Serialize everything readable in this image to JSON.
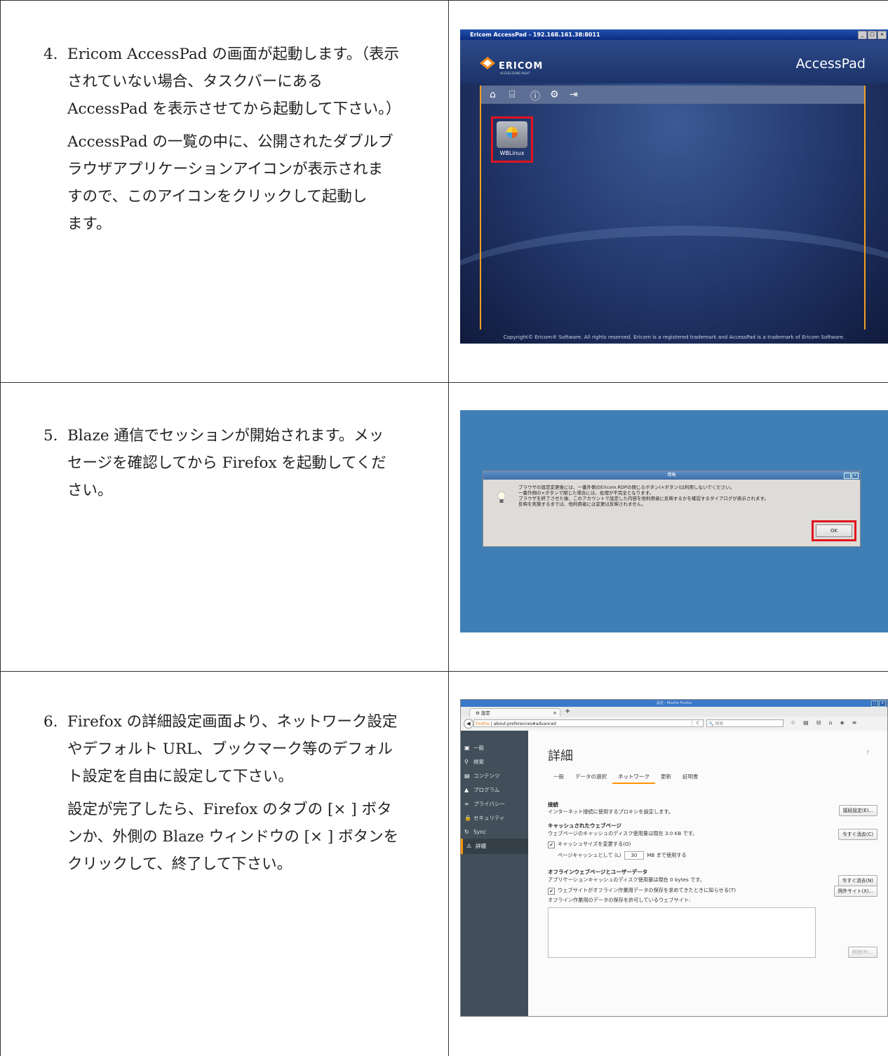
{
  "steps": [
    {
      "number": "4.",
      "paragraphs": [
        [
          "Ericom AccessPad の画面が起動します。（表示",
          "されていない場合、タスクバーにある",
          "AccessPad を表示させてから起動して下さい。）"
        ],
        [
          "AccessPad の一覧の中に、公開されたダブルブ",
          "ラウザアプリケーションアイコンが表示されま",
          "すので、このアイコンをクリックして起動し",
          "ます。"
        ]
      ]
    },
    {
      "number": "5.",
      "paragraphs": [
        [
          "Blaze 通信でセッションが開始されます。メッ",
          "セージを確認してから Firefox を起動してくだ",
          "さい。"
        ]
      ]
    },
    {
      "number": "6.",
      "paragraphs": [
        [
          "Firefox の詳細設定画面より、ネットワーク設定",
          "やデフォルト URL、ブックマーク等のデフォル",
          "ト設定を自由に設定して下さい。"
        ],
        [
          "設定が完了したら、Firefox のタブの [× ] ボタ",
          "ンか、外側の Blaze ウィンドウの [× ] ボタンを",
          "クリックして、終了して下さい。"
        ]
      ]
    }
  ],
  "accesspad": {
    "window_title": "Ericom AccessPad - 192.168.161.38:8011",
    "logo_text": "ERICOM",
    "logo_sub": "ACCESS DONE RIGHT",
    "brand": "AccessPad",
    "app_label": "WBLinux",
    "footer": "Copyright© Ericom® Software. All rights reserved. Ericom is a registered trademark and AccessPad is a trademark of Ericom Software.",
    "highlight_color": "#e0141e",
    "frame_color": "#f0a020"
  },
  "blaze_dialog": {
    "title": "情報",
    "lines": [
      "ブラウザの設定変更後には、一番外側のEricom.RDPの閉じるボタン(×ボタン)は利用しないでください。",
      "一番外側の×ボタンで閉じた場合には、処理が不完全となります。",
      "ブラウザを終了させた後、このアカウントで設定した内容を他利用者に反映するかを確認するダイアログが表示されます。",
      "反映を実施するまでは、他利用者には変更は反映されません。"
    ],
    "ok_label": "OK",
    "desktop_color": "#3f7fb6"
  },
  "firefox": {
    "window_title": "設定 - Mozilla Firefox",
    "tab_label": "設定",
    "url_brand": "Firefox",
    "url": "about:preferences#advanced",
    "search_placeholder": "検索",
    "sidebar": [
      "一般",
      "検索",
      "コンテンツ",
      "プログラム",
      "プライバシー",
      "セキュリティ",
      "Sync",
      "詳細"
    ],
    "heading": "詳細",
    "subtabs": [
      "一般",
      "データの選択",
      "ネットワーク",
      "更新",
      "証明書"
    ],
    "active_subtab": "ネットワーク",
    "connection_title": "接続",
    "connection_desc": "インターネット接続に使用するプロキシを設定します。",
    "connection_button": "接続設定(E)...",
    "cache_title": "キャッシュされたウェブページ",
    "cache_desc": "ウェブページのキャッシュのディスク使用量は現在 3.0 KB です。",
    "cache_clear_button": "今すぐ消去(C)",
    "cache_override_label": "キャッシュサイズを変更する(O)",
    "cache_size_prefix": "ページキャッシュとして (L)",
    "cache_size_value": "30",
    "cache_size_suffix": "MB まで使用する",
    "offline_title": "オフラインウェブページとユーザーデータ",
    "offline_desc": "アプリケーションキャッシュのディスク使用量は現在 0 bytes です。",
    "offline_clear_button": "今すぐ消去(N)",
    "offline_notify_label": "ウェブサイトがオフライン作業用データの保存を求めてきたときに知らせる(T)",
    "exceptions_button": "例外サイト(X)...",
    "offline_list_label": "オフライン作業用のデータの保存を許可しているウェブサイト:",
    "remove_button": "削除(R)...",
    "accent_color": "#ff9500"
  }
}
